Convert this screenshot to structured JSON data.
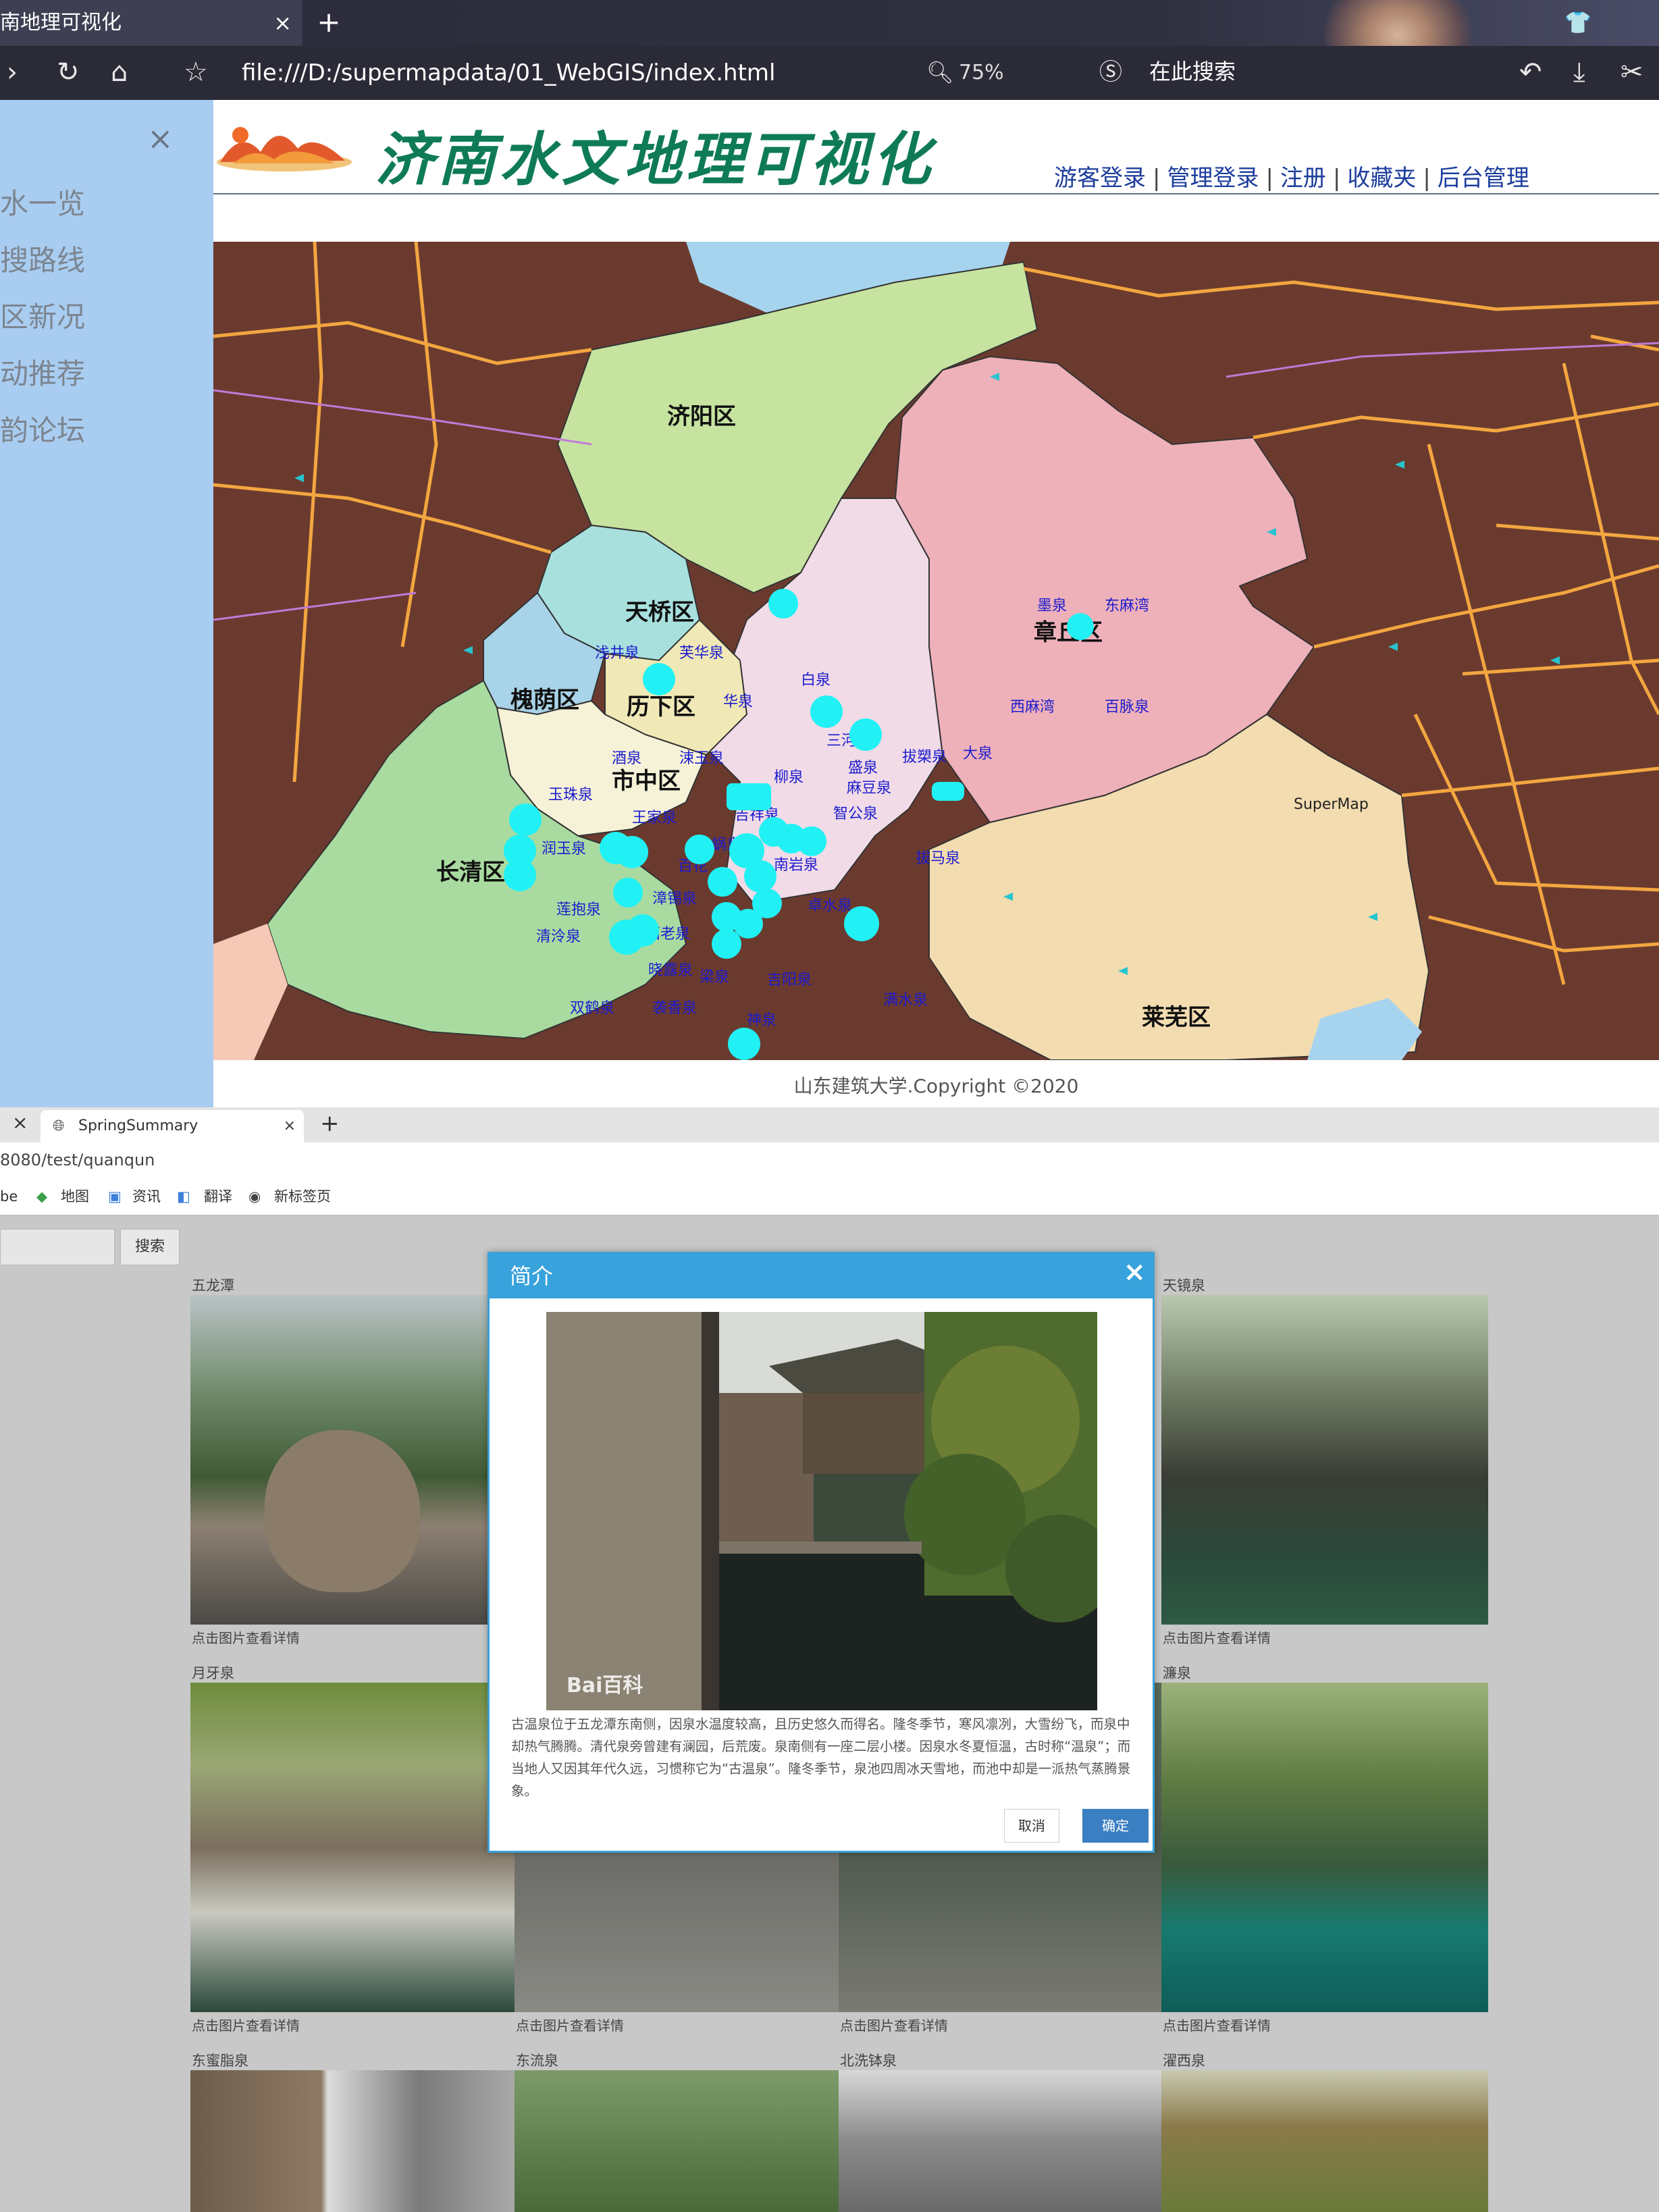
{
  "top_browser": {
    "tab_title": "南地理可视化",
    "tab_close": "×",
    "new_tab": "+",
    "url": "file:///D:/supermapdata/01_WebGIS/index.html",
    "zoom": "75%",
    "search_placeholder": "在此搜索",
    "sidebar": {
      "close": "×",
      "items": [
        "水一览",
        "搜路线",
        "区新况",
        "动推荐",
        "韵论坛"
      ]
    },
    "site_title": "济南水文地理可视化",
    "nav": [
      "游客登录",
      "管理登录",
      "注册",
      "收藏夹",
      "后台管理"
    ],
    "nav_sep": "|",
    "footer": "山东建筑大学.Copyright ©2020",
    "map": {
      "districts": [
        "济阳区",
        "天桥区",
        "槐荫区",
        "历下区",
        "市中区",
        "长清区",
        "章丘区",
        "莱芜区"
      ],
      "springs": [
        "浅井泉",
        "芙华泉",
        "白泉",
        "华泉",
        "三河泉",
        "拔槊泉",
        "大泉",
        "盛泉",
        "酒泉",
        "涑玉泉",
        "柳泉",
        "玉珠泉",
        "王家泉",
        "吉祥泉",
        "润玉泉",
        "百花",
        "南岩泉",
        "漳锡泉",
        "莲抱泉",
        "西老泉",
        "清泠泉",
        "晓露泉",
        "双鹤泉",
        "梁泉",
        "袭香泉",
        "吉阳泉",
        "神泉",
        "卓水泉",
        "满水泉",
        "拔马泉",
        "墨泉",
        "东麻湾",
        "西麻湾",
        "百脉泉",
        "智公泉",
        "麻豆泉",
        "蜗泉"
      ],
      "watermark": "SuperMap"
    }
  },
  "bottom_browser": {
    "tab_title": "SpringSummary",
    "tab_close": "×",
    "prev_tab_close": "×",
    "new_tab": "+",
    "address": "8080/test/quanqun",
    "bookmarks": [
      "be",
      "地图",
      "资讯",
      "翻译",
      "新标签页"
    ],
    "search_button": "搜索",
    "cards": [
      {
        "title": "五龙潭",
        "detail": "点击图片查看详情"
      },
      {
        "title": "天镜泉",
        "detail": "点击图片查看详情"
      },
      {
        "title": "月牙泉",
        "detail": "点击图片查看详情"
      },
      {
        "title": "",
        "detail": "点击图片查看详情"
      },
      {
        "title": "",
        "detail": "点击图片查看详情"
      },
      {
        "title": "濂泉",
        "detail": "点击图片查看详情"
      },
      {
        "title": "东蜜脂泉",
        "detail": ""
      },
      {
        "title": "东流泉",
        "detail": ""
      },
      {
        "title": "北洗钵泉",
        "detail": ""
      },
      {
        "title": "濯西泉",
        "detail": ""
      }
    ],
    "modal": {
      "title": "简介",
      "close": "×",
      "watermark": "Bai百科",
      "text": "古温泉位于五龙潭东南侧，因泉水温度较高，且历史悠久而得名。隆冬季节，寒风凛冽，大雪纷飞，而泉中却热气腾腾。清代泉旁曾建有澜园，后荒废。泉南侧有一座二层小楼。因泉水冬夏恒温，古时称“温泉”；而当地人又因其年代久远，习惯称它为“古温泉”。隆冬季节，泉池四周冰天雪地，而池中却是一派热气蒸腾景象。",
      "cancel": "取消",
      "ok": "确定"
    }
  }
}
